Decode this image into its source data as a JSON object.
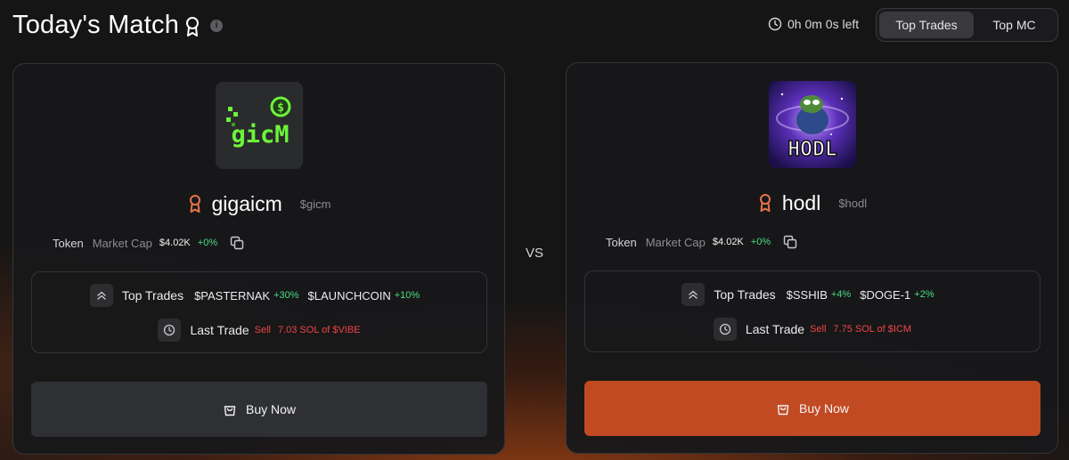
{
  "header": {
    "title": "Today's Match",
    "info_glyph": "i",
    "timer": "0h 0m 0s left",
    "tabs": [
      {
        "label": "Top Trades",
        "active": true
      },
      {
        "label": "Top MC",
        "active": false
      }
    ]
  },
  "vs_label": "VS",
  "left": {
    "logo_text": "gicM",
    "name": "gigaicm",
    "symbol": "$gicm",
    "token_label": "Token",
    "mc_label": "Market Cap",
    "mc_value": "$4.02K",
    "mc_change": "+0%",
    "top_trades_label": "Top Trades",
    "top_trades": [
      {
        "ticker": "$PASTERNAK",
        "change": "+30%"
      },
      {
        "ticker": "$LAUNCHCOIN",
        "change": "+10%"
      }
    ],
    "last_trade_label": "Last Trade",
    "last_trade_side": "Sell",
    "last_trade_desc": "7.03 SOL of $VIBE",
    "buy_label": "Buy Now"
  },
  "right": {
    "logo_text": "HODL",
    "name": "hodl",
    "symbol": "$hodl",
    "token_label": "Token",
    "mc_label": "Market Cap",
    "mc_value": "$4.02K",
    "mc_change": "+0%",
    "top_trades_label": "Top Trades",
    "top_trades": [
      {
        "ticker": "$SSHIB",
        "change": "+4%"
      },
      {
        "ticker": "$DOGE-1",
        "change": "+2%"
      }
    ],
    "last_trade_label": "Last Trade",
    "last_trade_side": "Sell",
    "last_trade_desc": "7.75 SOL of $ICM",
    "buy_label": "Buy Now"
  },
  "colors": {
    "accent_orange": "#c24a22",
    "positive": "#4ade80",
    "negative": "#ef4444",
    "medal": "#e8734a"
  }
}
